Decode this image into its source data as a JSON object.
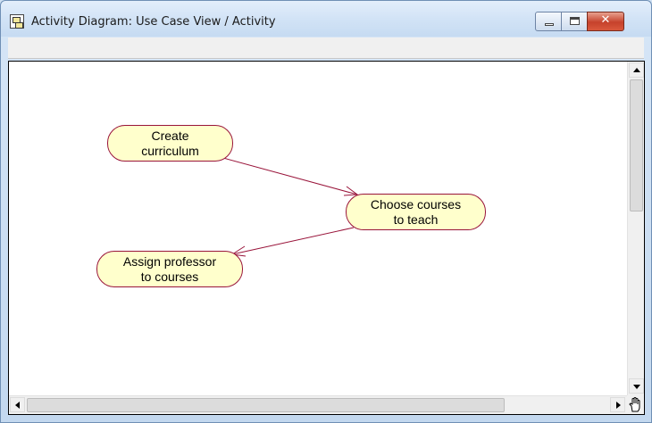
{
  "window": {
    "title": "Activity Diagram: Use Case View / Activity",
    "close_glyph": "✕"
  },
  "diagram": {
    "activities": [
      {
        "id": "create-curriculum",
        "label": "Create\ncurriculum"
      },
      {
        "id": "choose-courses",
        "label": "Choose courses\nto teach"
      },
      {
        "id": "assign-professor",
        "label": "Assign professor\nto courses"
      }
    ],
    "transitions": [
      {
        "from": "create-curriculum",
        "to": "choose-courses"
      },
      {
        "from": "choose-courses",
        "to": "assign-professor"
      }
    ]
  },
  "colors": {
    "activity_fill": "#ffffcc",
    "activity_border": "#99143a",
    "transition": "#99143a"
  },
  "icons": {
    "app": "diagram-icon",
    "scroll_corner": "hand-icon"
  }
}
